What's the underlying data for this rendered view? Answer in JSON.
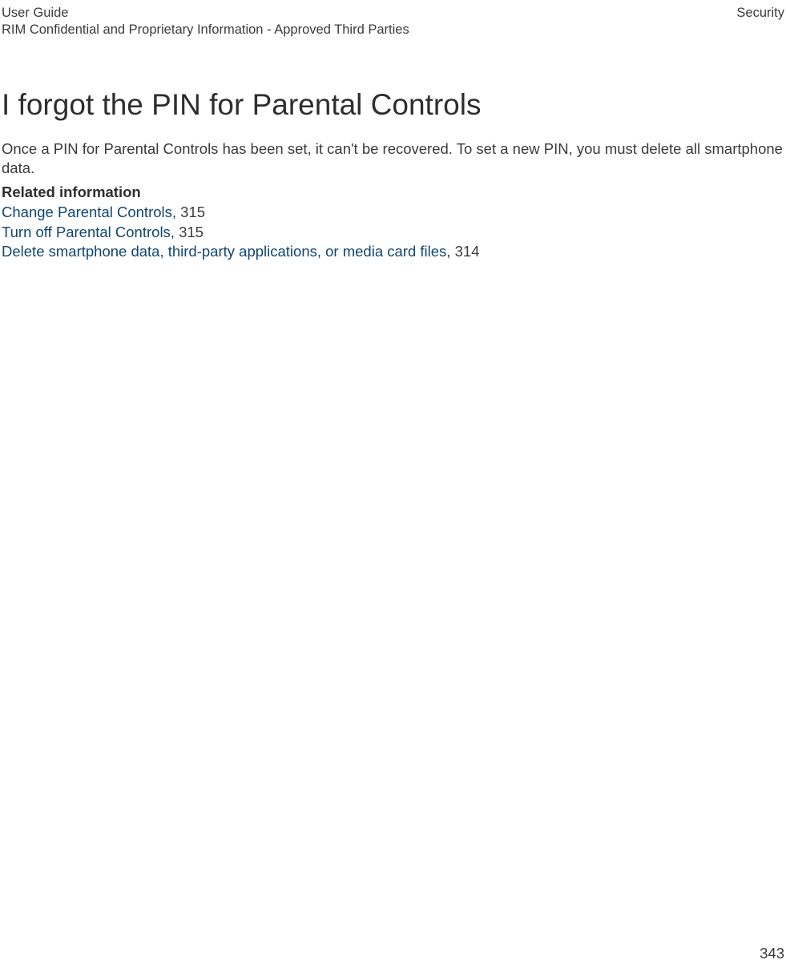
{
  "header": {
    "left_line1": "User Guide",
    "left_line2": "RIM Confidential and Proprietary Information - Approved Third Parties",
    "right": "Security"
  },
  "main": {
    "title": "I forgot the PIN for Parental Controls",
    "paragraph": "Once a PIN for Parental Controls has been set, it can't be recovered. To set a new PIN, you must delete all smartphone data.",
    "related_heading": "Related information",
    "related": [
      {
        "label": "Change Parental Controls, ",
        "page": "315"
      },
      {
        "label": "Turn off Parental Controls, ",
        "page": "315"
      },
      {
        "label": "Delete smartphone data, third-party applications, or media card files, ",
        "page": "314"
      }
    ]
  },
  "footer": {
    "page_number": "343"
  }
}
